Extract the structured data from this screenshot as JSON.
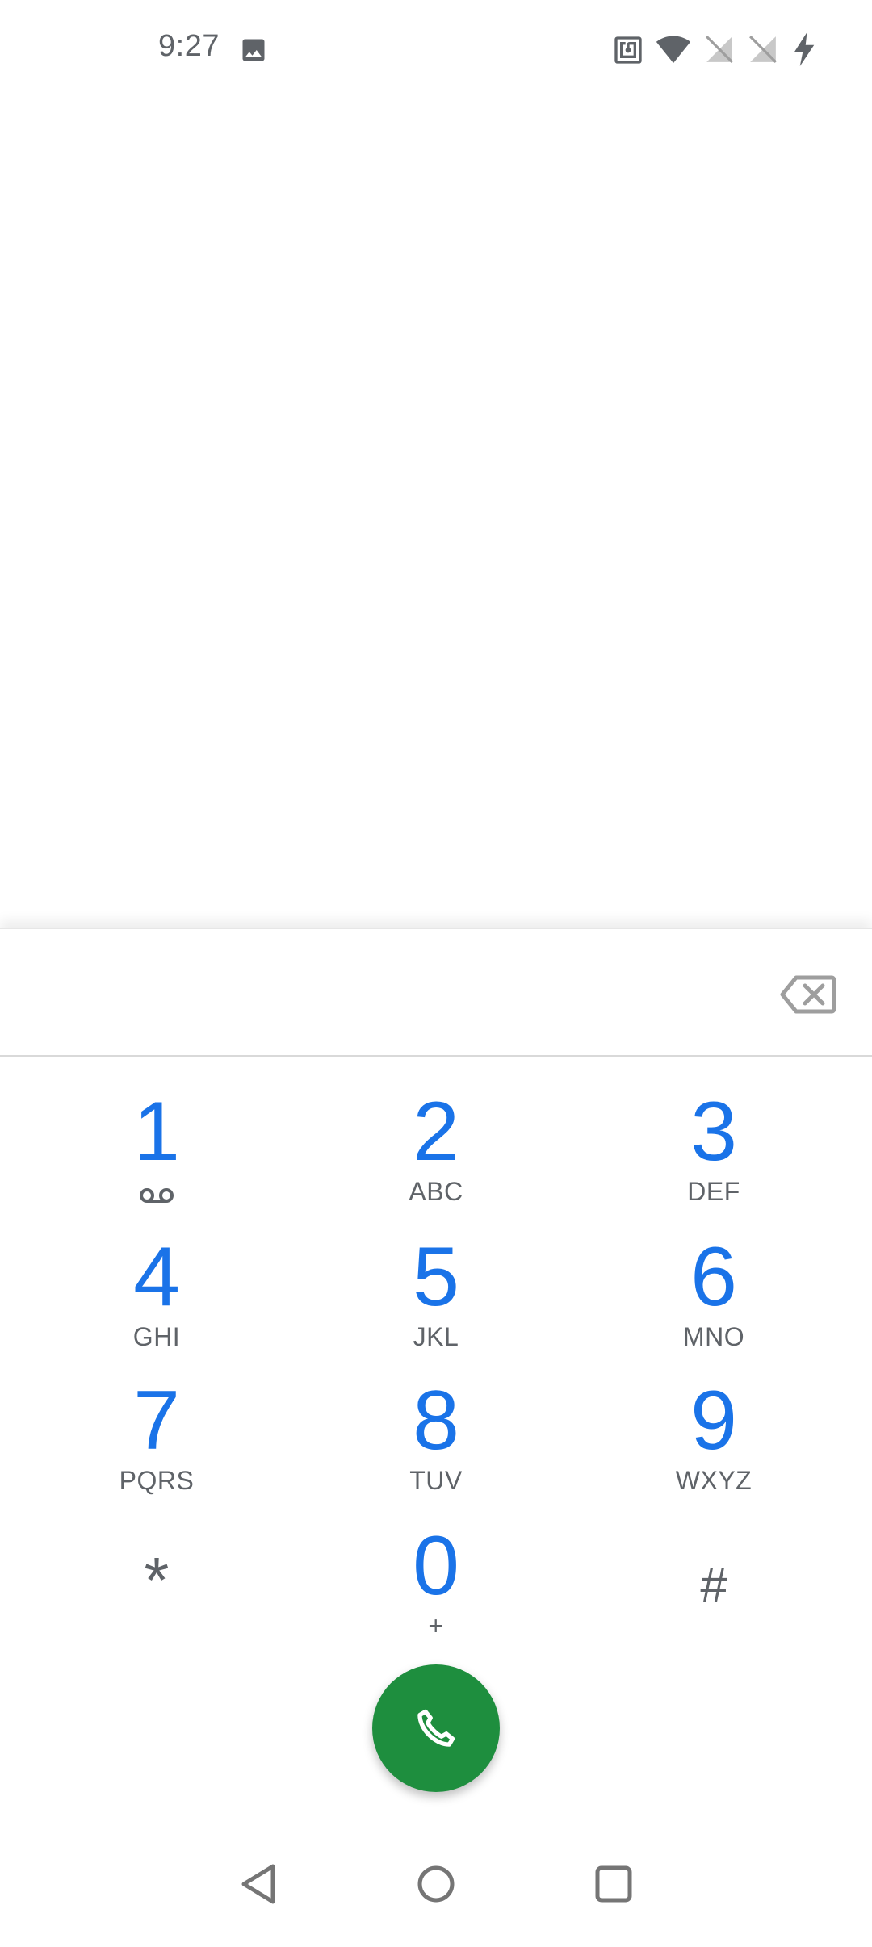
{
  "status_bar": {
    "time": "9:27",
    "icons": [
      "image-icon",
      "nfc-icon",
      "wifi-icon",
      "no-sim-icon",
      "no-sim-icon",
      "charging-icon"
    ]
  },
  "dialpad": {
    "digits_value": "",
    "keys": [
      {
        "digit": "1",
        "sub": "",
        "sub_icon": "voicemail-icon"
      },
      {
        "digit": "2",
        "sub": "ABC"
      },
      {
        "digit": "3",
        "sub": "DEF"
      },
      {
        "digit": "4",
        "sub": "GHI"
      },
      {
        "digit": "5",
        "sub": "JKL"
      },
      {
        "digit": "6",
        "sub": "MNO"
      },
      {
        "digit": "7",
        "sub": "PQRS"
      },
      {
        "digit": "8",
        "sub": "TUV"
      },
      {
        "digit": "9",
        "sub": "WXYZ"
      },
      {
        "digit": "*",
        "sub": ""
      },
      {
        "digit": "0",
        "sub": "+"
      },
      {
        "digit": "#",
        "sub": ""
      }
    ]
  },
  "colors": {
    "digit": "#1a73e8",
    "sub": "#5f6368",
    "call": "#1e8e3e"
  },
  "icons": {
    "backspace": "backspace-icon",
    "call": "phone-icon",
    "nav_back": "back-triangle-icon",
    "nav_home": "home-circle-icon",
    "nav_recents": "recents-square-icon"
  }
}
